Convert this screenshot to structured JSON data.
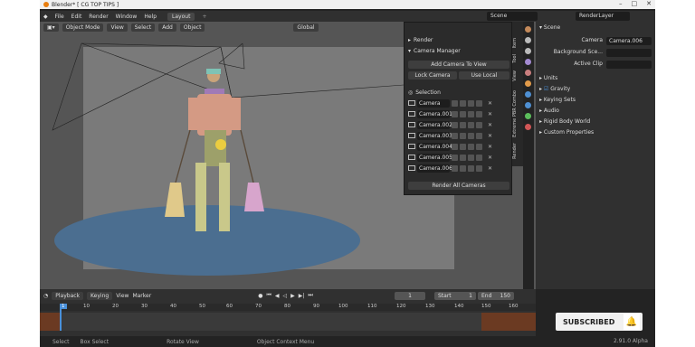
{
  "window": {
    "title": "Blender* [ CG TOP TIPS ]"
  },
  "menubar": {
    "items": [
      "File",
      "Edit",
      "Render",
      "Window",
      "Help"
    ],
    "workspace_tab": "Layout",
    "add_tab": "+"
  },
  "scene": {
    "selector": "Scene",
    "render_layer": "RenderLayer"
  },
  "viewport": {
    "mode": "Object Mode",
    "menus": [
      "View",
      "Select",
      "Add",
      "Object"
    ],
    "transform_orientation": "Global"
  },
  "npanel": {
    "render_header": "Render",
    "camera_manager_header": "Camera Manager",
    "add_camera_button": "Add Camera To View",
    "lock_camera_button": "Lock Camera",
    "use_local_button": "Use Local",
    "selection_label": "Selection",
    "cameras": [
      "Camera",
      "Camera.001",
      "Camera.002",
      "Camera.003",
      "Camera.004",
      "Camera.005",
      "Camera.006"
    ],
    "render_all_button": "Render All Cameras",
    "side_tabs": [
      "Item",
      "Tool",
      "View",
      "Extreme PBR Combo",
      "Render"
    ]
  },
  "properties": {
    "section": "Scene",
    "camera_label": "Camera",
    "camera_value": "Camera.006",
    "background_label": "Background Sce...",
    "active_clip_label": "Active Clip",
    "subsections": [
      "Units",
      "Gravity",
      "Keying Sets",
      "Audio",
      "Rigid Body World",
      "Custom Properties"
    ]
  },
  "timeline": {
    "menus": [
      "Playback",
      "Keying",
      "View",
      "Marker"
    ],
    "current_frame": "1",
    "start_label": "Start",
    "start_value": "1",
    "end_label": "End",
    "end_value": "150",
    "ticks": [
      "1",
      "10",
      "20",
      "30",
      "40",
      "50",
      "60",
      "70",
      "80",
      "90",
      "100",
      "110",
      "120",
      "130",
      "140",
      "150",
      "160"
    ]
  },
  "statusbar": {
    "items": [
      "Select",
      "Box Select",
      "Rotate View",
      "Object Context Menu"
    ],
    "version": "2.91.0 Alpha"
  },
  "overlay": {
    "subscribed_label": "SUBSCRIBED"
  },
  "colors": {
    "accent": "#4a90d9",
    "timeline_range": "#6b3a22",
    "stage": "#4b6e90"
  }
}
